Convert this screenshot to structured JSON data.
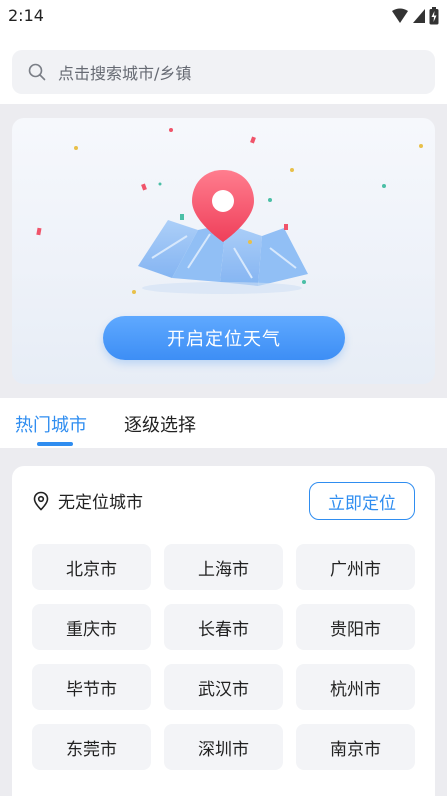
{
  "status_bar": {
    "time": "2:14"
  },
  "search": {
    "placeholder": "点击搜索城市/乡镇"
  },
  "locate_card": {
    "button_label": "开启定位天气"
  },
  "tabs": [
    {
      "label": "热门城市",
      "active": true
    },
    {
      "label": "逐级选择",
      "active": false
    }
  ],
  "location": {
    "status_text": "无定位城市",
    "locate_button_label": "立即定位"
  },
  "hot_cities": [
    "北京市",
    "上海市",
    "广州市",
    "重庆市",
    "长春市",
    "贵阳市",
    "毕节市",
    "武汉市",
    "杭州市",
    "东莞市",
    "深圳市",
    "南京市"
  ],
  "colors": {
    "accent": "#2f8df0",
    "pin": "#f0546a",
    "background": "#ececf0"
  },
  "icons": [
    "wifi-icon",
    "signal-icon",
    "battery-icon",
    "search-icon",
    "location-pin-icon",
    "map-pin-illustration"
  ]
}
